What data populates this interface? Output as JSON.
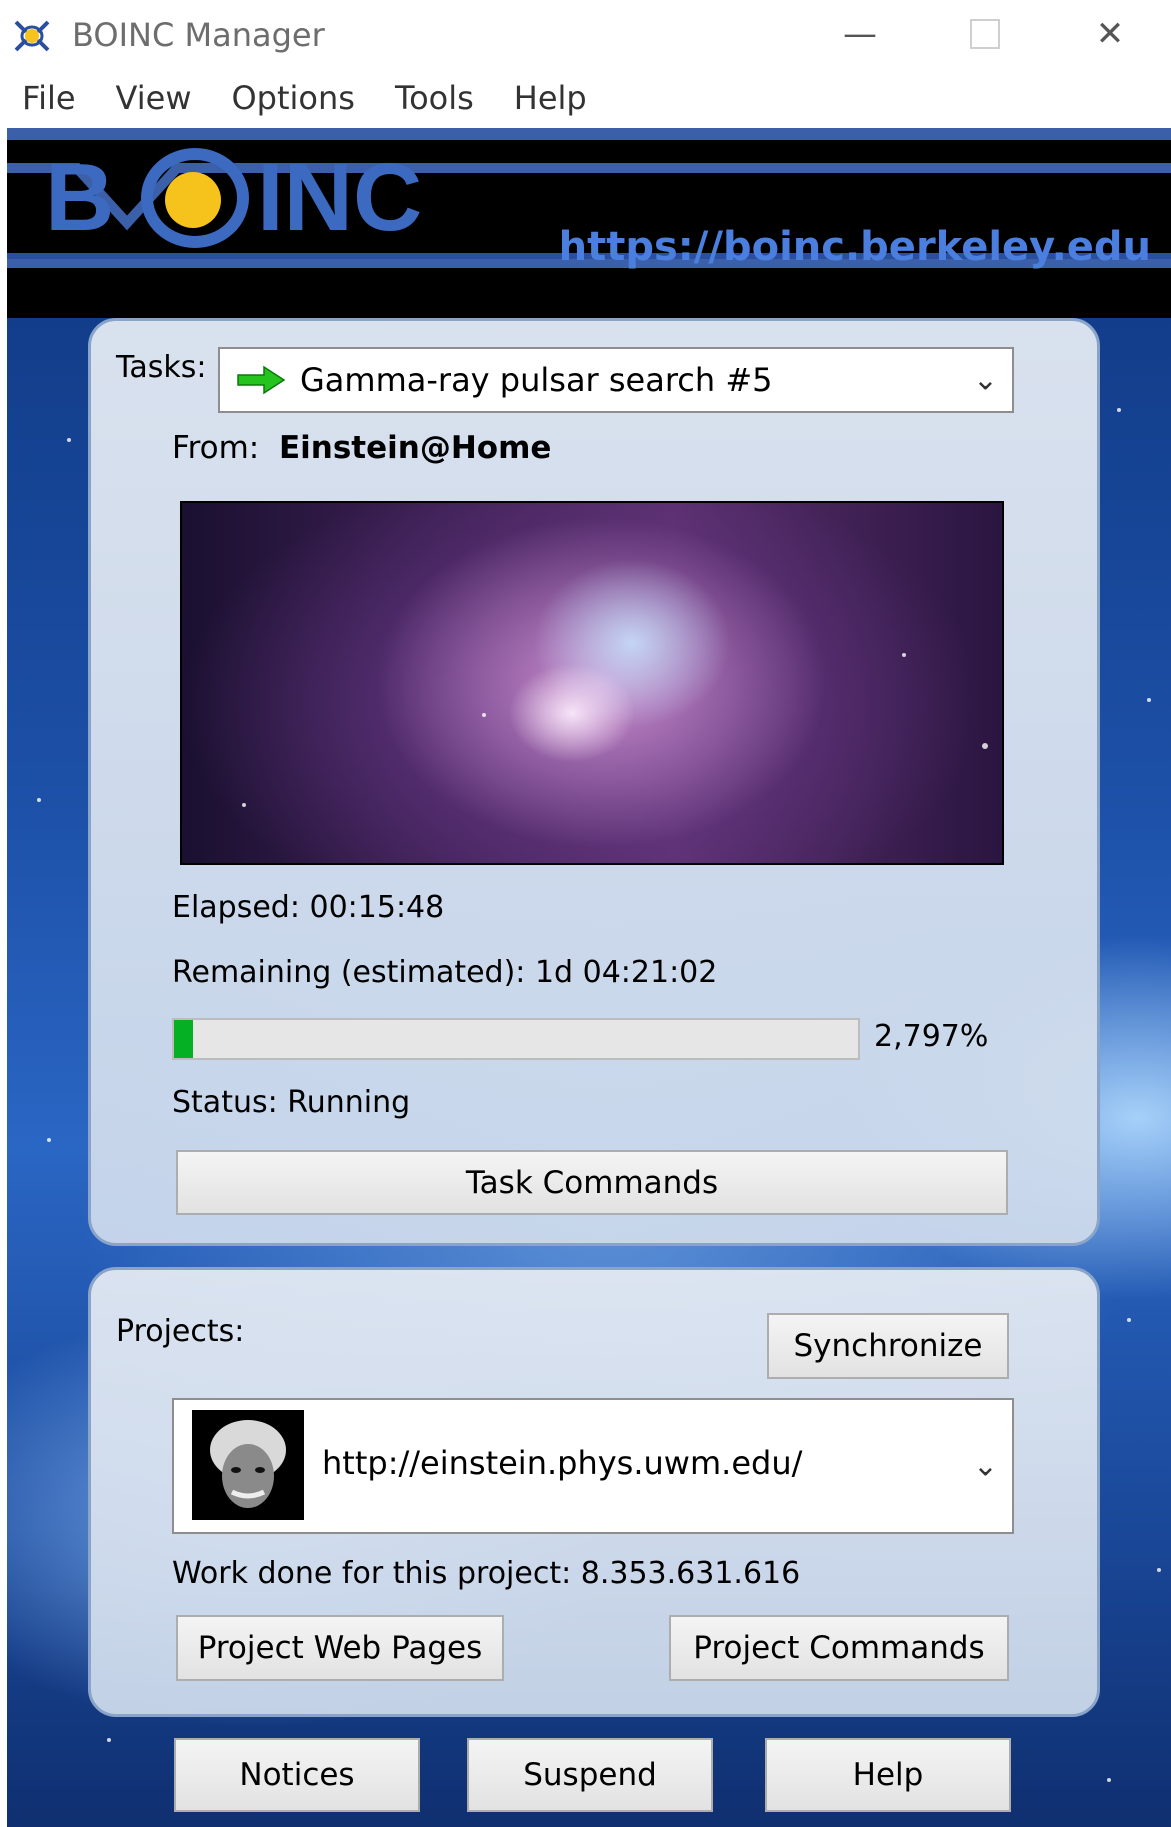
{
  "window": {
    "title": "BOINC Manager",
    "minimize_glyph": "—",
    "close_glyph": "✕"
  },
  "menu": [
    "File",
    "View",
    "Options",
    "Tools",
    "Help"
  ],
  "banner": {
    "logo_text": "BOINC",
    "url": "https://boinc.berkeley.edu"
  },
  "tasks": {
    "label": "Tasks:",
    "selected": "Gamma-ray pulsar search #5",
    "selected_icon": "green-arrow-icon",
    "from_label": "From:",
    "from_value": "Einstein@Home",
    "elapsed": "Elapsed: 00:15:48",
    "remaining": "Remaining (estimated): 1d 04:21:02",
    "progress_percent": 2.797,
    "progress_text": "2,797%",
    "status": "Status: Running",
    "commands_button": "Task Commands"
  },
  "projects": {
    "label": "Projects:",
    "sync_button": "Synchronize",
    "selected_url": "http://einstein.phys.uwm.edu/",
    "work_done": "Work done for this project: 8.353.631.616",
    "web_pages_button": "Project Web Pages",
    "commands_button": "Project Commands"
  },
  "bottom_buttons": {
    "notices": "Notices",
    "suspend": "Suspend",
    "help": "Help"
  },
  "colors": {
    "banner_blue": "#4a7fe0",
    "progress_green": "#06b025",
    "logo_yellow": "#f6c21c"
  }
}
